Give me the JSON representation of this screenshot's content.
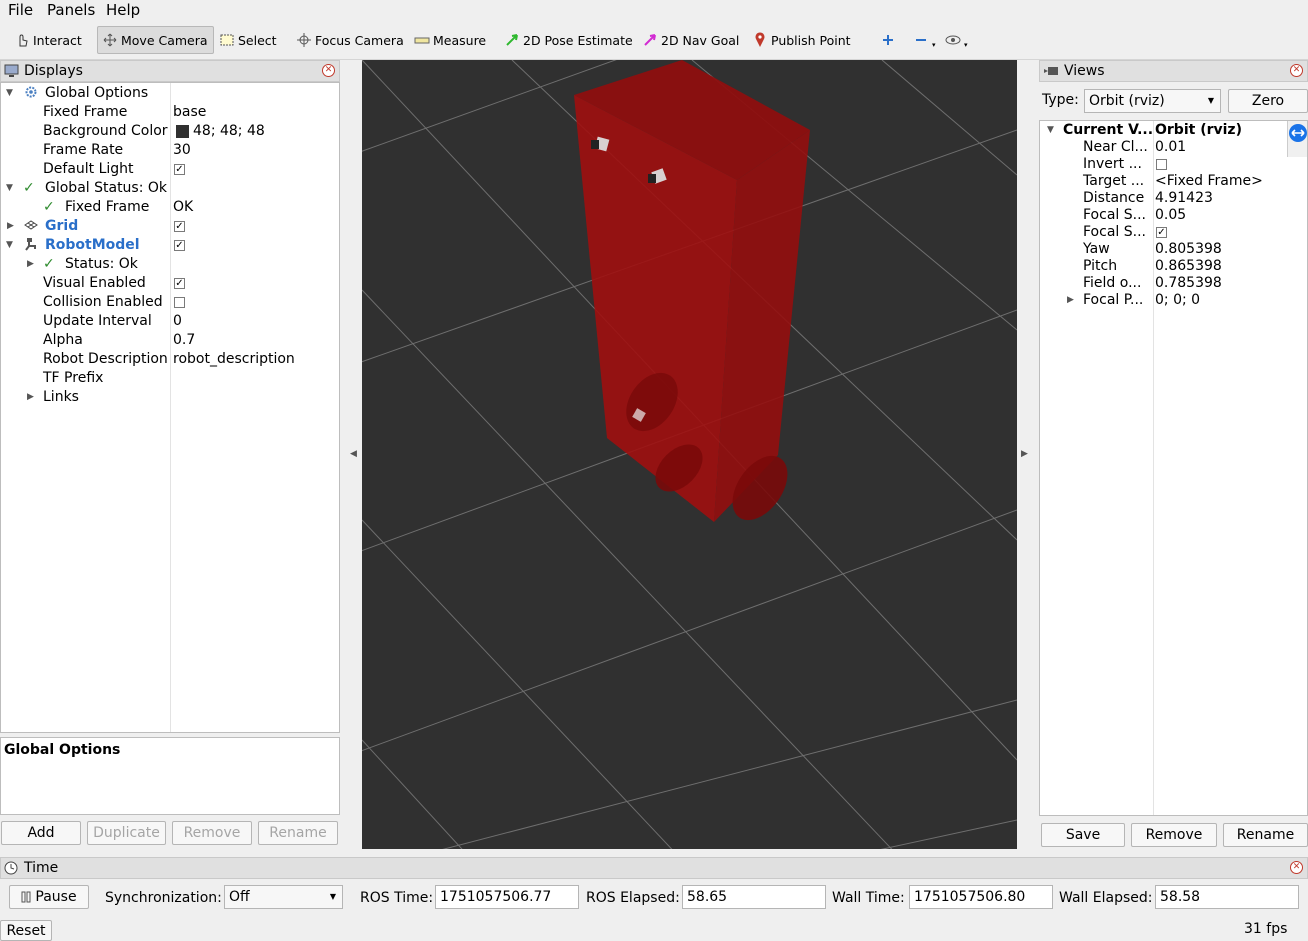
{
  "menu": {
    "file": "File",
    "panels": "Panels",
    "help": "Help"
  },
  "toolbar": {
    "interact": "Interact",
    "move_camera": "Move Camera",
    "select": "Select",
    "focus_camera": "Focus Camera",
    "measure": "Measure",
    "pose_estimate": "2D Pose Estimate",
    "nav_goal": "2D Nav Goal",
    "publish_point": "Publish Point"
  },
  "displays": {
    "title": "Displays",
    "rows": {
      "global_options": "Global Options",
      "fixed_frame_k": "Fixed Frame",
      "fixed_frame_v": "base",
      "bg_color_k": "Background Color",
      "bg_color_v": "48; 48; 48",
      "frame_rate_k": "Frame Rate",
      "frame_rate_v": "30",
      "default_light_k": "Default Light",
      "global_status": "Global Status: Ok",
      "gs_fixed_frame_k": "Fixed Frame",
      "gs_fixed_frame_v": "OK",
      "grid": "Grid",
      "robot_model": "RobotModel",
      "status_ok": "Status: Ok",
      "visual_enabled_k": "Visual Enabled",
      "collision_enabled_k": "Collision Enabled",
      "update_interval_k": "Update Interval",
      "update_interval_v": "0",
      "alpha_k": "Alpha",
      "alpha_v": "0.7",
      "robot_description_k": "Robot Description",
      "robot_description_v": "robot_description",
      "tf_prefix_k": "TF Prefix",
      "links_k": "Links"
    },
    "description_title": "Global Options",
    "buttons": {
      "add": "Add",
      "duplicate": "Duplicate",
      "remove": "Remove",
      "rename": "Rename"
    }
  },
  "views": {
    "title": "Views",
    "type_label": "Type:",
    "type_value": "Orbit (rviz)",
    "zero": "Zero",
    "rows": {
      "current_k": "Current V...",
      "current_v": "Orbit (rviz)",
      "near_k": "Near Cl...",
      "near_v": "0.01",
      "invert_k": "Invert ...",
      "target_k": "Target ...",
      "target_v": "<Fixed Frame>",
      "distance_k": "Distance",
      "distance_v": "4.91423",
      "focal_s1_k": "Focal S...",
      "focal_s1_v": "0.05",
      "focal_s2_k": "Focal S...",
      "yaw_k": "Yaw",
      "yaw_v": "0.805398",
      "pitch_k": "Pitch",
      "pitch_v": "0.865398",
      "field_k": "Field o...",
      "field_v": "0.785398",
      "focal_p_k": "Focal P...",
      "focal_p_v": "0; 0; 0"
    },
    "buttons": {
      "save": "Save",
      "remove": "Remove",
      "rename": "Rename"
    }
  },
  "time": {
    "title": "Time",
    "pause": "Pause",
    "sync_label": "Synchronization:",
    "sync_value": "Off",
    "ros_time_label": "ROS Time:",
    "ros_time": "1751057506.77",
    "ros_elapsed_label": "ROS Elapsed:",
    "ros_elapsed": "58.65",
    "wall_time_label": "Wall Time:",
    "wall_time": "1751057506.80",
    "wall_elapsed_label": "Wall Elapsed:",
    "wall_elapsed": "58.58"
  },
  "status": {
    "reset": "Reset",
    "fps": "31 fps"
  },
  "colors": {
    "background": "#303030",
    "robot": "#a01010",
    "accent": "#2a6fc9"
  }
}
